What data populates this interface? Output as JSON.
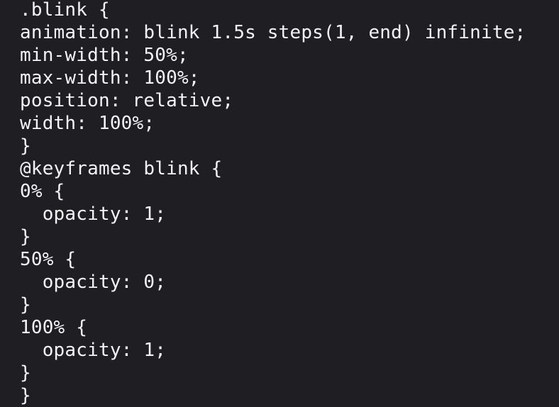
{
  "editor": {
    "lines": [
      ".blink {",
      "animation: blink 1.5s steps(1, end) infinite;",
      "min-width: 50%;",
      "max-width: 100%;",
      "position: relative;",
      "width: 100%;",
      "}",
      "@keyframes blink {",
      "0% {",
      "  opacity: 1;",
      "}",
      "50% {",
      "  opacity: 0;",
      "}",
      "100% {",
      "  opacity: 1;",
      "}",
      "}"
    ],
    "colors": {
      "background": "#1e1e23",
      "text": "#f4f4f5"
    }
  }
}
